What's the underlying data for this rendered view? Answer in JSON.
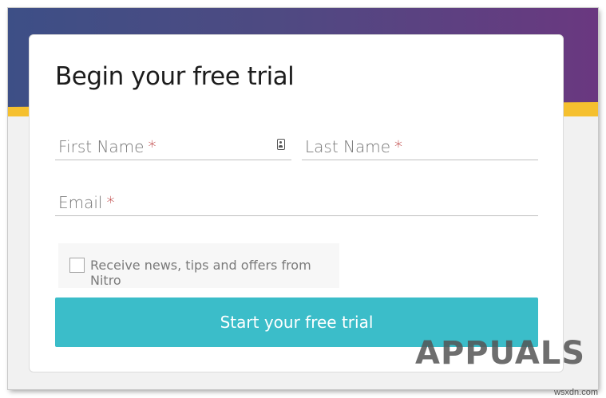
{
  "form": {
    "title": "Begin your free trial",
    "first_name": {
      "label": "First Name",
      "required_mark": "*",
      "icon": "contact-card-icon"
    },
    "last_name": {
      "label": "Last Name",
      "required_mark": "*"
    },
    "email": {
      "label": "Email",
      "required_mark": "*"
    },
    "consent_label": "Receive news, tips and offers from Nitro",
    "submit_label": "Start your free trial"
  },
  "watermark": "APPUALS",
  "source_label": "wsxdn.com",
  "colors": {
    "header_gradient_start": "#3d4f86",
    "header_gradient_end": "#6a3880",
    "stripe": "#f5c02f",
    "button": "#3bbdc9",
    "required": "#b22222"
  }
}
